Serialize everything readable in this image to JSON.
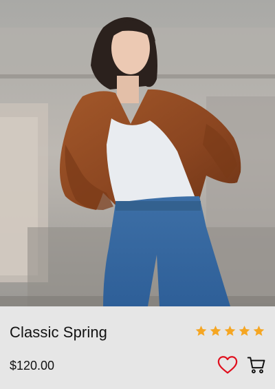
{
  "product": {
    "image_alt": "woman-in-brown-leather-jacket",
    "title": "Classic Spring",
    "price": "$120.00",
    "rating": 5,
    "rating_max": 5
  },
  "colors": {
    "star": "#f5a623",
    "heart": "#e0101e",
    "cart": "#111111",
    "info_bg": "#e6e6e6"
  },
  "icons": {
    "favorite": "heart-outline-icon",
    "cart": "shopping-cart-icon",
    "star": "star-icon"
  }
}
